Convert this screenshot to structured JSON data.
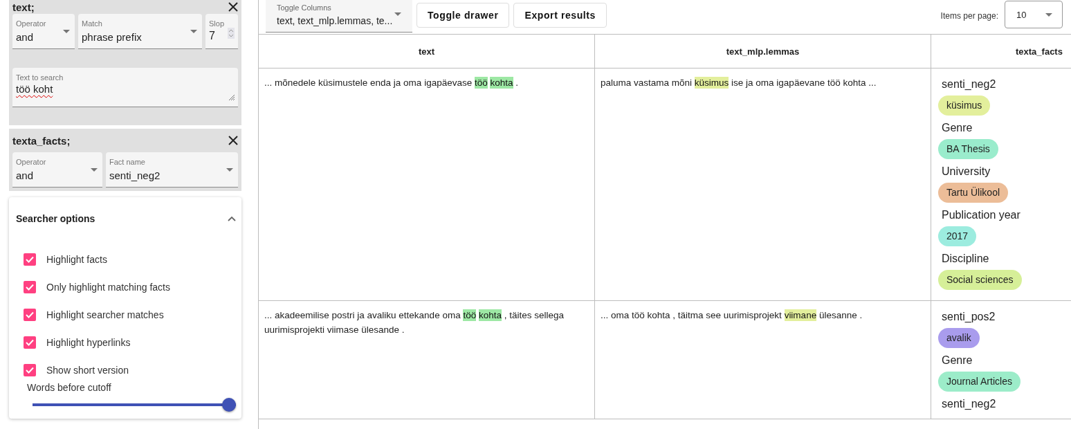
{
  "filters": [
    {
      "title": "text;",
      "fields": [
        {
          "kind": "select",
          "label": "Operator",
          "value": "and"
        },
        {
          "kind": "select",
          "label": "Match",
          "value": "phrase prefix"
        },
        {
          "kind": "number",
          "label": "Slop",
          "value": "7"
        },
        {
          "kind": "textarea",
          "label": "Text to search",
          "value": "töö koht"
        }
      ]
    },
    {
      "title": "texta_facts;",
      "fields": [
        {
          "kind": "select",
          "label": "Operator",
          "value": "and"
        },
        {
          "kind": "select",
          "label": "Fact name",
          "value": "senti_neg2"
        }
      ]
    }
  ],
  "searcher_options": {
    "title": "Searcher options",
    "expanded": true,
    "options": [
      {
        "label": "Highlight facts",
        "checked": true
      },
      {
        "label": "Only highlight matching facts",
        "checked": true
      },
      {
        "label": "Highlight searcher matches",
        "checked": true
      },
      {
        "label": "Highlight hyperlinks",
        "checked": true
      },
      {
        "label": "Show short version",
        "checked": true
      }
    ],
    "slider": {
      "label": "Words before cutoff",
      "level": 1
    }
  },
  "toolbar": {
    "toggle_columns": {
      "label": "Toggle Columns",
      "value": "text, text_mlp.lemmas, te..."
    },
    "buttons": [
      "Toggle drawer",
      "Export results"
    ],
    "items_per_page": {
      "label": "Items per page:",
      "value": "10"
    }
  },
  "table": {
    "columns": [
      "text",
      "text_mlp.lemmas",
      "texta_facts"
    ],
    "rows": [
      {
        "text": [
          {
            "text": "... mõnedele küsimustele enda ja oma igapäevase "
          },
          {
            "text": "töö kohta",
            "color": "#9de8a4"
          },
          {
            "text": " ."
          }
        ],
        "lemmas": [
          {
            "text": "paluma vastama mõni "
          },
          {
            "text": "küsimus",
            "color": "#e3ef9c"
          },
          {
            "text": " ise ja oma igapäevane töö kohta ..."
          }
        ],
        "facts": [
          {
            "name": "senti_neg2",
            "value": "küsimus",
            "color": "#e3ef9c"
          },
          {
            "name": "Genre",
            "value": "BA Thesis",
            "color": "#9aeccc"
          },
          {
            "name": "University",
            "value": "Tartu Ülikool",
            "color": "#ecbd98"
          },
          {
            "name": "Publication year",
            "value": "2017",
            "color": "#9cecdf"
          },
          {
            "name": "Discipline",
            "value": "Social sciences",
            "color": "#d6ef98"
          }
        ]
      },
      {
        "text": [
          {
            "text": "... akadeemilise postri ja avaliku ettekande oma "
          },
          {
            "text": "töö kohta",
            "color": "#9de8a4"
          },
          {
            "text": " , täites sellega uurimisprojekti viimase ülesande ."
          }
        ],
        "lemmas": [
          {
            "text": "... oma töö kohta , täitma see uurimisprojekt "
          },
          {
            "text": "viimane",
            "color": "#e3ef9c"
          },
          {
            "text": " ülesanne ."
          }
        ],
        "facts": [
          {
            "name": "senti_pos2",
            "value": "avalik",
            "color": "#a99ced"
          },
          {
            "name": "Genre",
            "value": "Journal Articles",
            "color": "#9cecc9"
          },
          {
            "name": "senti_neg2"
          }
        ]
      }
    ]
  }
}
